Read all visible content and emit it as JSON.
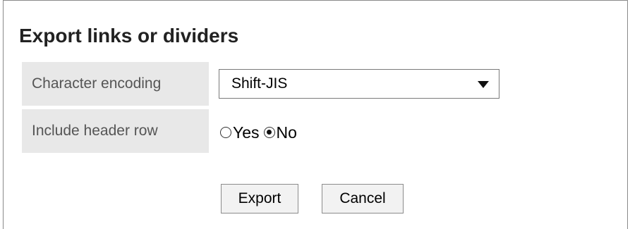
{
  "dialog": {
    "title": "Export links or dividers"
  },
  "fields": {
    "encoding_label": "Character encoding",
    "encoding_value": "Shift-JIS",
    "header_label": "Include header row",
    "header_options": [
      {
        "label": "Yes",
        "checked": false
      },
      {
        "label": "No",
        "checked": true
      }
    ]
  },
  "actions": {
    "export_label": "Export",
    "cancel_label": "Cancel"
  }
}
